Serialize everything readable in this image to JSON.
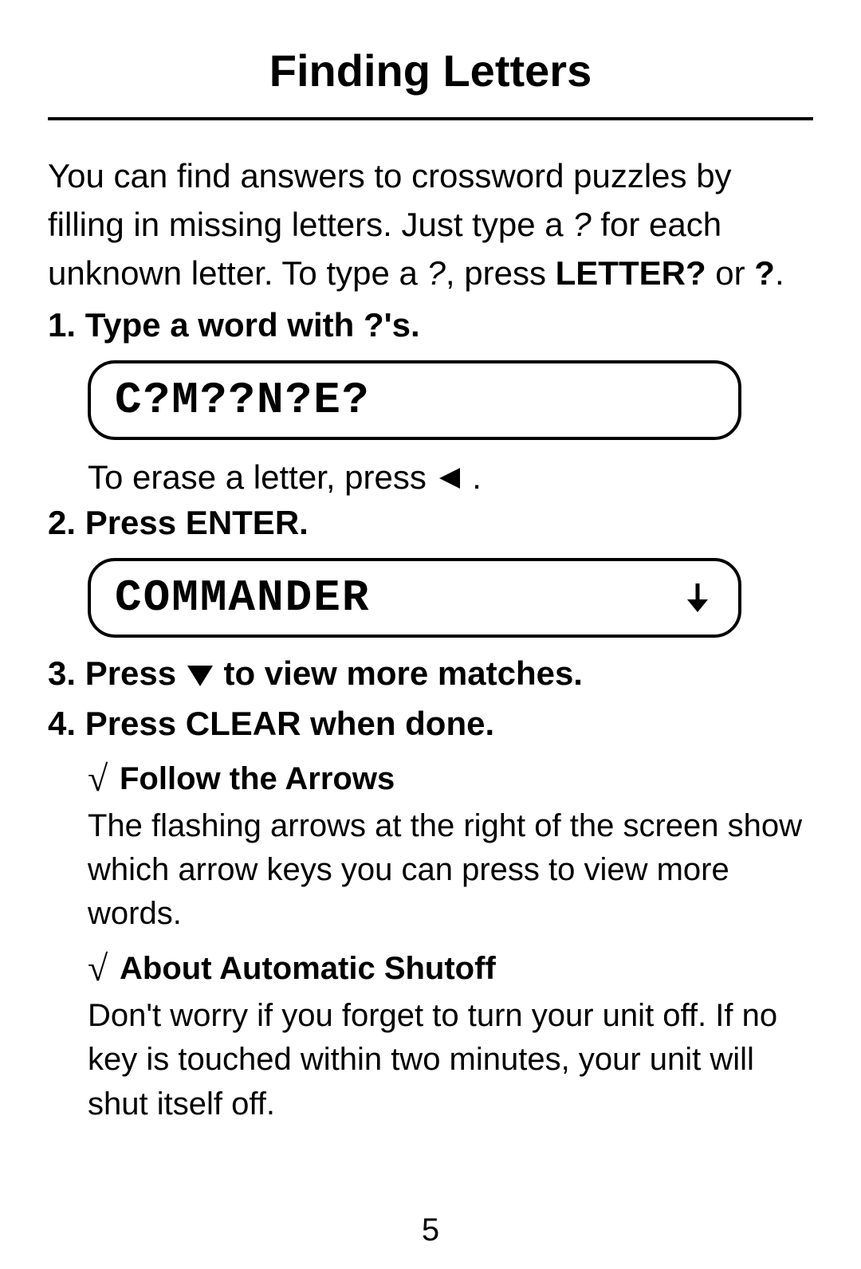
{
  "title": "Finding Letters",
  "intro": {
    "line1_a": "You can find answers to crossword puzzles by filling in missing letters. Just type a ",
    "q1": "?",
    "line1_b": " for each unknown letter. To type a ",
    "q2": "?",
    "line1_c": ", press ",
    "key_letter": "LETTER?",
    "line1_d": " or ",
    "key_q": "?",
    "line1_e": "."
  },
  "steps": {
    "s1": "1. Type a word with ?'s.",
    "lcd1": "C?M??N?E?",
    "erase_a": "To erase a letter, press ",
    "erase_b": ".",
    "s2": "2. Press ENTER.",
    "lcd2": "COMMANDER",
    "lcd2_arrow": "↓",
    "s3_a": "3. Press ",
    "s3_b": " to view more matches.",
    "s4": "4. Press CLEAR when done."
  },
  "tips": {
    "t1_heading": "Follow the Arrows",
    "t1_body": "The flashing arrows at the right of the screen show which arrow keys you can press to view more words.",
    "t2_heading": "About Automatic Shutoff",
    "t2_body": "Don't worry if you forget to turn your unit off. If no key is touched within two minutes, your unit will shut itself off."
  },
  "root_symbol": "√",
  "page_number": "5"
}
